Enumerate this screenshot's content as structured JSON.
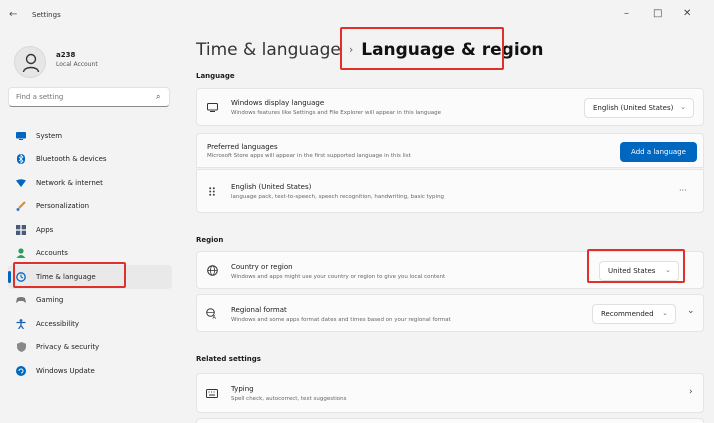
{
  "window": {
    "back_glyph": "←",
    "title": "Settings",
    "controls": {
      "minimize": "–",
      "maximize": "□",
      "close": "✕"
    }
  },
  "user": {
    "name": "a238",
    "account_type": "Local Account"
  },
  "search": {
    "placeholder": "Find a setting",
    "icon": "search-icon"
  },
  "sidebar": {
    "items": [
      {
        "label": "System",
        "icon": "monitor-icon",
        "color": "#0067c0"
      },
      {
        "label": "Bluetooth & devices",
        "icon": "bluetooth-icon",
        "color": "#0067c0"
      },
      {
        "label": "Network & internet",
        "icon": "wifi-icon",
        "color": "#0067c0"
      },
      {
        "label": "Personalization",
        "icon": "brush-icon",
        "color": "#d98b2b"
      },
      {
        "label": "Apps",
        "icon": "apps-icon",
        "color": "#4a5a7a"
      },
      {
        "label": "Accounts",
        "icon": "person-icon",
        "color": "#2aa05a"
      },
      {
        "label": "Time & language",
        "icon": "clock-globe-icon",
        "color": "#0067c0",
        "active": true
      },
      {
        "label": "Gaming",
        "icon": "gamepad-icon",
        "color": "#777777"
      },
      {
        "label": "Accessibility",
        "icon": "accessibility-icon",
        "color": "#1a5fb4"
      },
      {
        "label": "Privacy & security",
        "icon": "shield-icon",
        "color": "#888888"
      },
      {
        "label": "Windows Update",
        "icon": "update-icon",
        "color": "#0067c0"
      }
    ]
  },
  "breadcrumb": {
    "parent": "Time & language",
    "separator": "›",
    "current": "Language & region"
  },
  "language": {
    "heading": "Language",
    "display_language": {
      "title": "Windows display language",
      "desc": "Windows features like Settings and File Explorer will appear in this language",
      "value": "English (United States)",
      "icon": "monitor-icon"
    },
    "preferred": {
      "title": "Preferred languages",
      "desc": "Microsoft Store apps will appear in the first supported language in this list",
      "button": "Add a language"
    },
    "installed": {
      "title": "English (United States)",
      "desc": "language pack, text-to-speech, speech recognition, handwriting, basic typing",
      "more": "···",
      "icon": "drag-handle-icon"
    }
  },
  "region": {
    "heading": "Region",
    "country": {
      "title": "Country or region",
      "desc": "Windows and apps might use your country or region to give you local content",
      "value": "United States",
      "icon": "globe-icon"
    },
    "format": {
      "title": "Regional format",
      "desc": "Windows and some apps format dates and times based on your regional format",
      "value": "Recommended",
      "icon": "regional-format-icon"
    }
  },
  "related": {
    "heading": "Related settings",
    "typing": {
      "title": "Typing",
      "desc": "Spell check, autocorrect, text suggestions",
      "icon": "keyboard-icon"
    }
  },
  "colors": {
    "accent": "#0067c0",
    "highlight": "#e0302b"
  }
}
